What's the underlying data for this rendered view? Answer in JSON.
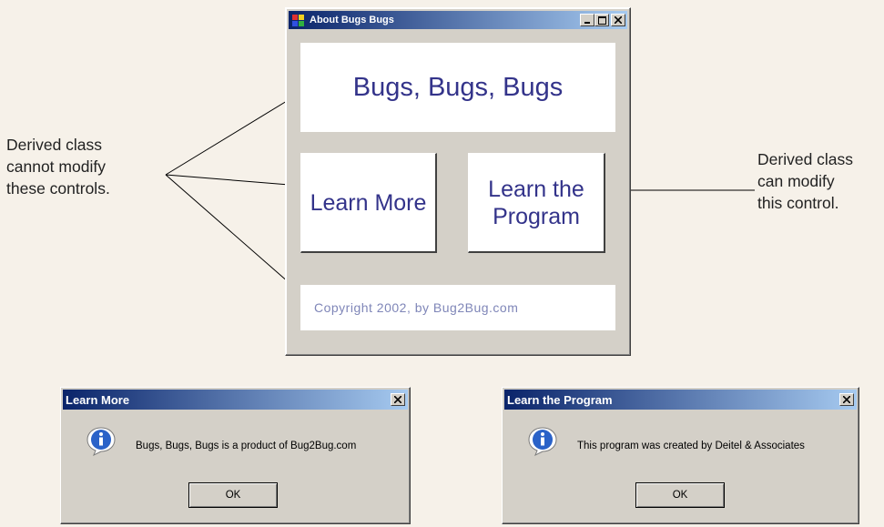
{
  "main_window": {
    "title": "About Bugs Bugs",
    "product_label": "Bugs, Bugs, Bugs",
    "learn_more_button": "Learn More",
    "learn_program_button": "Learn the Program",
    "copyright": "Copyright 2002, by Bug2Bug.com"
  },
  "annotations": {
    "left_note_lines": [
      "Derived class",
      "cannot modify",
      "these controls."
    ],
    "right_note_lines": [
      "Derived class",
      "can modify",
      "this control."
    ]
  },
  "dialogs": [
    {
      "title": "Learn More",
      "message": "Bugs, Bugs, Bugs is a product of Bug2Bug.com",
      "ok_label": "OK"
    },
    {
      "title": "Learn the Program",
      "message": "This program was created by Deitel & Associates",
      "ok_label": "OK"
    }
  ],
  "colors": {
    "titlebar_start": "#0a246a",
    "titlebar_end": "#a6caf0",
    "label_text": "#33338a",
    "window_face": "#d4d0c8"
  }
}
